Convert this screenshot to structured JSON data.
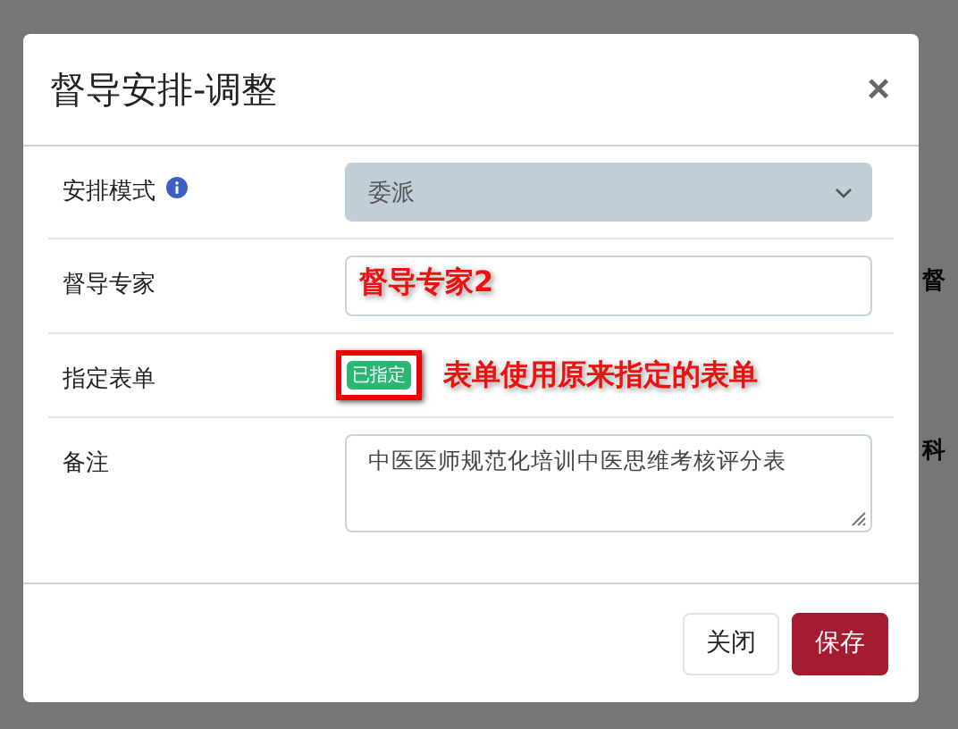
{
  "background": {
    "fragments": [
      {
        "text": "督"
      },
      {
        "text": "科"
      }
    ]
  },
  "dialog": {
    "title": "督导安排-调整",
    "close": "×",
    "fields": [
      {
        "kind": "select",
        "label": "安排模式",
        "info": true,
        "value": "委派",
        "disabled": true
      },
      {
        "kind": "input",
        "label": "督导专家",
        "annotation": "督导专家2"
      },
      {
        "kind": "badge",
        "label": "指定表单",
        "badge": "已指定",
        "highlighted": true,
        "annotation": "表单使用原来指定的表单"
      },
      {
        "kind": "textarea",
        "label": "备注",
        "value": "中医医师规范化培训中医思维考核评分表"
      }
    ],
    "buttons": [
      {
        "label": "关闭",
        "kind": "secondary"
      },
      {
        "label": "保存",
        "kind": "primary"
      }
    ]
  }
}
